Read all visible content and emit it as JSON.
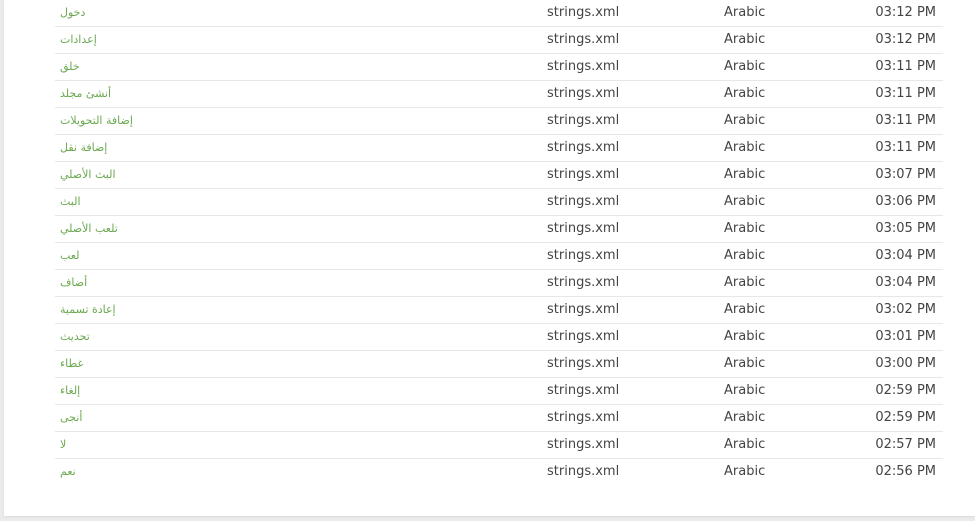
{
  "rows": [
    {
      "text": "دخول",
      "file": "strings.xml",
      "language": "Arabic",
      "time": "03:12 PM"
    },
    {
      "text": "إعدادات",
      "file": "strings.xml",
      "language": "Arabic",
      "time": "03:12 PM"
    },
    {
      "text": "خلق",
      "file": "strings.xml",
      "language": "Arabic",
      "time": "03:11 PM"
    },
    {
      "text": "أنشئ مجلد",
      "file": "strings.xml",
      "language": "Arabic",
      "time": "03:11 PM"
    },
    {
      "text": "إضافة التحويلات",
      "file": "strings.xml",
      "language": "Arabic",
      "time": "03:11 PM"
    },
    {
      "text": "إضافة نقل",
      "file": "strings.xml",
      "language": "Arabic",
      "time": "03:11 PM"
    },
    {
      "text": "البث الأصلي",
      "file": "strings.xml",
      "language": "Arabic",
      "time": "03:07 PM"
    },
    {
      "text": "البث",
      "file": "strings.xml",
      "language": "Arabic",
      "time": "03:06 PM"
    },
    {
      "text": "تلعب الأصلي",
      "file": "strings.xml",
      "language": "Arabic",
      "time": "03:05 PM"
    },
    {
      "text": "لعب",
      "file": "strings.xml",
      "language": "Arabic",
      "time": "03:04 PM"
    },
    {
      "text": "أضاف",
      "file": "strings.xml",
      "language": "Arabic",
      "time": "03:04 PM"
    },
    {
      "text": "إعادة تسمية",
      "file": "strings.xml",
      "language": "Arabic",
      "time": "03:02 PM"
    },
    {
      "text": "تحديث",
      "file": "strings.xml",
      "language": "Arabic",
      "time": "03:01 PM"
    },
    {
      "text": "غطاء",
      "file": "strings.xml",
      "language": "Arabic",
      "time": "03:00 PM"
    },
    {
      "text": "إلغاء",
      "file": "strings.xml",
      "language": "Arabic",
      "time": "02:59 PM"
    },
    {
      "text": "أنجى",
      "file": "strings.xml",
      "language": "Arabic",
      "time": "02:59 PM"
    },
    {
      "text": "لا",
      "file": "strings.xml",
      "language": "Arabic",
      "time": "02:57 PM"
    },
    {
      "text": "نعم",
      "file": "strings.xml",
      "language": "Arabic",
      "time": "02:56 PM"
    }
  ],
  "colors": {
    "link_text": "#6aa84f",
    "body_text": "#444444",
    "row_divider": "#e7e7e7",
    "page_background": "#ebebeb",
    "panel_background": "#ffffff"
  }
}
